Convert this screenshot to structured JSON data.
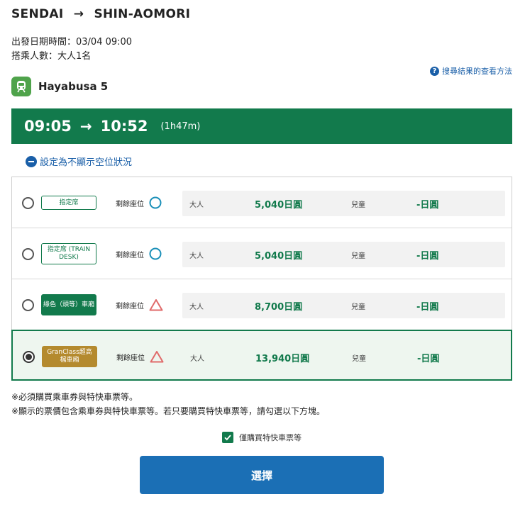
{
  "route": {
    "from": "SENDAI",
    "arrow": "→",
    "to": "SHIN-AOMORI"
  },
  "meta": {
    "departure": "出發日期時間：03/04 09:00",
    "passengers": "搭乘人數：大人1名"
  },
  "help": {
    "icon": "question-circle-icon",
    "label": "搜尋結果的查看方法"
  },
  "train": {
    "icon": "train-icon",
    "name": "Hayabusa 5"
  },
  "timebar": {
    "depart": "09:05",
    "arrow": "→",
    "arrive": "10:52",
    "duration": "(1h47m)"
  },
  "toggle": {
    "icon": "minus-circle-icon",
    "label": "設定為不顯示空位狀況"
  },
  "colors": {
    "brand_green": "#127a4c",
    "button_blue": "#1b6fb5",
    "link_blue": "#1a5fa8",
    "gold": "#b48a2e"
  },
  "rows": [
    {
      "badge": "指定席",
      "badge_style": "outline",
      "seat_label": "剩餘座位",
      "availability": "circle",
      "adult_label": "大人",
      "adult_price": "5,040日圓",
      "child_label": "兒童",
      "child_price": "-日圓",
      "selected": false
    },
    {
      "badge": "指定席 (TRAIN DESK)",
      "badge_style": "outline",
      "seat_label": "剩餘座位",
      "availability": "circle",
      "adult_label": "大人",
      "adult_price": "5,040日圓",
      "child_label": "兒童",
      "child_price": "-日圓",
      "selected": false
    },
    {
      "badge": "綠色（頭等）車廂",
      "badge_style": "green",
      "seat_label": "剩餘座位",
      "availability": "triangle",
      "adult_label": "大人",
      "adult_price": "8,700日圓",
      "child_label": "兒童",
      "child_price": "-日圓",
      "selected": false
    },
    {
      "badge": "GranClass超高檔車廂",
      "badge_style": "gold",
      "seat_label": "剩餘座位",
      "availability": "triangle",
      "adult_label": "大人",
      "adult_price": "13,940日圓",
      "child_label": "兒童",
      "child_price": "-日圓",
      "selected": true
    }
  ],
  "notes": {
    "line1": "※必須購買乘車券與特快車票等。",
    "line2": "※顯示的票價包含乘車券與特快車票等。若只要購買特快車票等，請勾選以下方塊。"
  },
  "express_only": {
    "label": "僅購買特快車票等",
    "checked": true
  },
  "select_button": {
    "label": "選擇"
  }
}
